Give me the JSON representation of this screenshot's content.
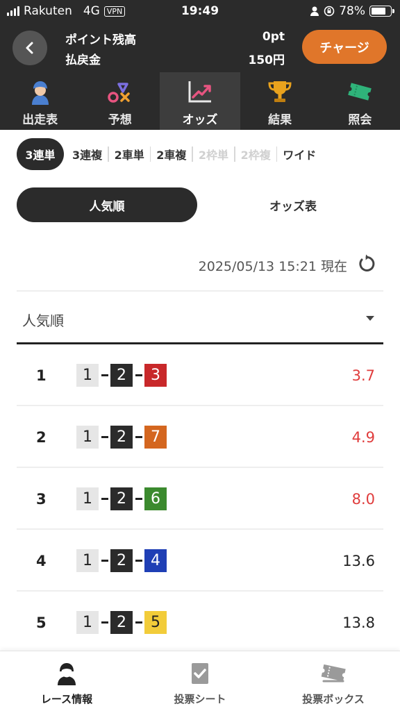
{
  "status_bar": {
    "carrier": "Rakuten",
    "network": "4G",
    "vpn": "VPN",
    "time": "19:49",
    "battery": "78%",
    "battery_level": 0.78
  },
  "header": {
    "points_label": "ポイント残高",
    "points_value": "0pt",
    "refund_label": "払戻金",
    "refund_value": "150円",
    "charge_label": "チャージ"
  },
  "main_nav": [
    {
      "label": "出走表",
      "icon": "rider-icon"
    },
    {
      "label": "予想",
      "icon": "prediction-icon"
    },
    {
      "label": "オッズ",
      "icon": "odds-chart-icon"
    },
    {
      "label": "結果",
      "icon": "trophy-icon"
    },
    {
      "label": "照会",
      "icon": "ticket-icon"
    }
  ],
  "bet_types": [
    "3連単",
    "3連複",
    "2車単",
    "2車複",
    "2枠単",
    "2枠複",
    "ワイド"
  ],
  "segment": {
    "popular": "人気順",
    "odds_table": "オッズ表"
  },
  "timestamp": "2025/05/13 15:21 現在",
  "sort": {
    "label": "人気順"
  },
  "colors": {
    "1": {
      "bg": "#e6e6e6",
      "fg": "#222222"
    },
    "2": {
      "bg": "#2b2b2b",
      "fg": "#ffffff"
    },
    "3": {
      "bg": "#c8282a",
      "fg": "#ffffff"
    },
    "4": {
      "bg": "#1f3fb5",
      "fg": "#ffffff"
    },
    "5": {
      "bg": "#f2cc3a",
      "fg": "#222222"
    },
    "6": {
      "bg": "#3b8a2e",
      "fg": "#ffffff"
    },
    "7": {
      "bg": "#d4661f",
      "fg": "#ffffff"
    },
    "odds_low": "#e03c3c",
    "odds_normal": "#222222"
  },
  "rows": [
    {
      "rank": "1",
      "combo": [
        "1",
        "2",
        "3"
      ],
      "odds": "3.7",
      "highlight": true
    },
    {
      "rank": "2",
      "combo": [
        "1",
        "2",
        "7"
      ],
      "odds": "4.9",
      "highlight": true
    },
    {
      "rank": "3",
      "combo": [
        "1",
        "2",
        "6"
      ],
      "odds": "8.0",
      "highlight": true
    },
    {
      "rank": "4",
      "combo": [
        "1",
        "2",
        "4"
      ],
      "odds": "13.6",
      "highlight": false
    },
    {
      "rank": "5",
      "combo": [
        "1",
        "2",
        "5"
      ],
      "odds": "13.8",
      "highlight": false
    }
  ],
  "bottom_nav": [
    {
      "label": "レース情報",
      "icon": "rider-icon"
    },
    {
      "label": "投票シート",
      "icon": "check-sheet-icon"
    },
    {
      "label": "投票ボックス",
      "icon": "ticket-box-icon"
    }
  ]
}
